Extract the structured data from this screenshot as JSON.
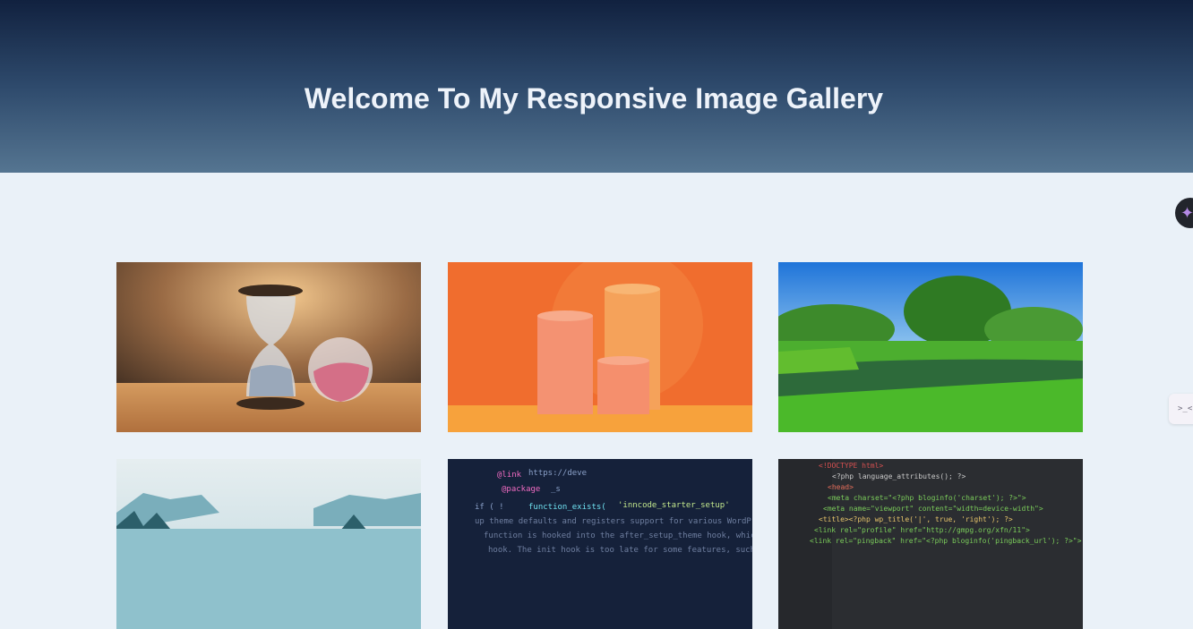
{
  "header": {
    "title": "Welcome To My Responsive Image Gallery"
  },
  "gallery": {
    "images": [
      {
        "name": "hourglass"
      },
      {
        "name": "orange-cylinders"
      },
      {
        "name": "lake-landscape"
      },
      {
        "name": "mountains"
      },
      {
        "name": "code-screen-blue"
      },
      {
        "name": "code-screen-dark"
      }
    ]
  },
  "floating": {
    "assistant_icon": "sparkle-icon",
    "tab_glyph": ">_<"
  }
}
